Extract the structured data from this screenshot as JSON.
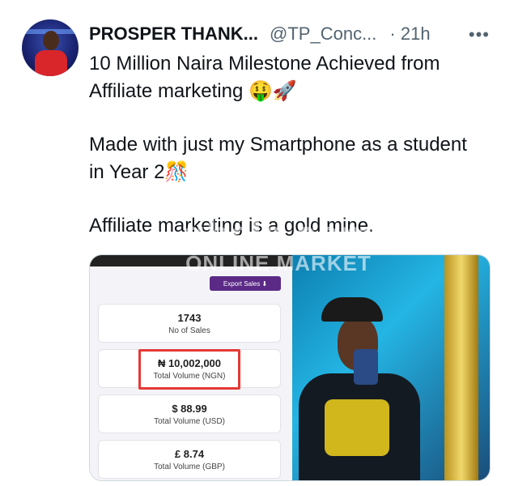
{
  "tweet": {
    "author_name": "PROSPER THANK...",
    "handle": "@TP_Conc...",
    "time": "· 21h",
    "more_icon": "•••",
    "lines": {
      "l1": "10 Million Naira Milestone Achieved from",
      "l2": "Affiliate marketing 🤑🚀",
      "l3": "Made with just my Smartphone as a student",
      "l4": "in Year 2🎊",
      "l5": "Affiliate marketing is a gold mine."
    }
  },
  "media": {
    "export_label": "Export Sales ⬇",
    "stats": [
      {
        "value": "1743",
        "label": "No of Sales"
      },
      {
        "value": "₦ 10,002,000",
        "label": "Total Volume (NGN)"
      },
      {
        "value": "$ 88.99",
        "label": "Total Volume (USD)"
      },
      {
        "value": "£ 8.74",
        "label": "Total Volume (GBP)"
      }
    ],
    "watermark_top": "gbele.com",
    "watermark_bottom": "ONLINE MARKET"
  },
  "colors": {
    "text": "#0f1419",
    "muted": "#536471",
    "highlight": "#e53935"
  }
}
